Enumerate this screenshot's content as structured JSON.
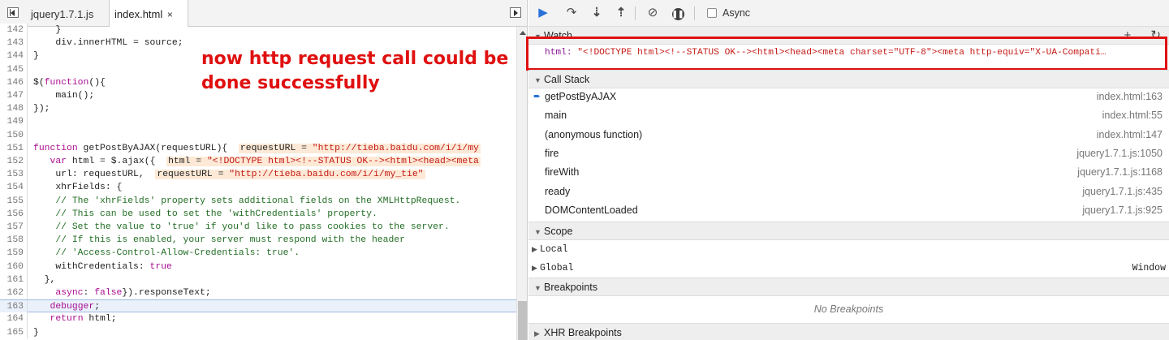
{
  "editor": {
    "tabs": [
      {
        "label": "jquery1.7.1.js"
      },
      {
        "label": "index.html",
        "close": "×"
      }
    ],
    "lines": [
      {
        "n": "142",
        "html": "    }"
      },
      {
        "n": "143",
        "html": "    div.innerHTML = source;"
      },
      {
        "n": "144",
        "html": "}"
      },
      {
        "n": "145",
        "html": ""
      },
      {
        "n": "146",
        "html": "$(<span class=\"kw\">function</span>(){"
      },
      {
        "n": "147",
        "html": "    main();"
      },
      {
        "n": "148",
        "html": "});"
      },
      {
        "n": "149",
        "html": ""
      },
      {
        "n": "150",
        "html": ""
      },
      {
        "n": "151",
        "html": "<span class=\"kw\">function</span> getPostByAJAX(requestURL){  <span class=\"inl\">requestURL = <span class=\"s\">\"http://tieba.baidu.com/i/i/my</span></span>"
      },
      {
        "n": "152",
        "html": "   <span class=\"kw\">var</span> html = $.ajax({  <span class=\"inl\">html = <span class=\"s\">\"&lt;!DOCTYPE html&gt;&lt;!--STATUS OK--&gt;&lt;html&gt;&lt;head&gt;&lt;meta</span></span>"
      },
      {
        "n": "153",
        "html": "    url: requestURL,  <span class=\"inl\">requestURL = <span class=\"s\">\"http://tieba.baidu.com/i/i/my_tie\"</span></span>"
      },
      {
        "n": "154",
        "html": "    xhrFields: {"
      },
      {
        "n": "155",
        "html": "    <span class=\"cm\">// The 'xhrFields' property sets additional fields on the XMLHttpRequest.</span>"
      },
      {
        "n": "156",
        "html": "    <span class=\"cm\">// This can be used to set the 'withCredentials' property.</span>"
      },
      {
        "n": "157",
        "html": "    <span class=\"cm\">// Set the value to 'true' if you'd like to pass cookies to the server.</span>"
      },
      {
        "n": "158",
        "html": "    <span class=\"cm\">// If this is enabled, your server must respond with the header</span>"
      },
      {
        "n": "159",
        "html": "    <span class=\"cm\">// 'Access-Control-Allow-Credentials: true'.</span>"
      },
      {
        "n": "160",
        "html": "    withCredentials: <span class=\"kw\">true</span>"
      },
      {
        "n": "161",
        "html": "  },"
      },
      {
        "n": "162",
        "html": "    <span class=\"kw\">async</span>: <span class=\"kw\">false</span>}).responseText;"
      },
      {
        "n": "163",
        "html": "   <span class=\"kw\">debugger</span>;",
        "exec": true
      },
      {
        "n": "164",
        "html": "   <span class=\"kw\">return</span> html;"
      },
      {
        "n": "165",
        "html": "}"
      }
    ],
    "annotation": {
      "line1": "now http request call could be",
      "line2": "done successfully"
    }
  },
  "toolbar": {
    "async_label": "Async"
  },
  "watch": {
    "title": "Watch",
    "add": "+",
    "refresh": "↻",
    "key": "html:",
    "value": "\"<!DOCTYPE html><!--STATUS OK--><html><head><meta charset=\"UTF-8\"><meta http-equiv=\"X-UA-Compati…"
  },
  "call_stack": {
    "title": "Call Stack",
    "frames": [
      {
        "name": "getPostByAJAX",
        "loc": "index.html:163",
        "current": true
      },
      {
        "name": "main",
        "loc": "index.html:55"
      },
      {
        "name": "(anonymous function)",
        "loc": "index.html:147"
      },
      {
        "name": "fire",
        "loc": "jquery1.7.1.js:1050"
      },
      {
        "name": "fireWith",
        "loc": "jquery1.7.1.js:1168"
      },
      {
        "name": "ready",
        "loc": "jquery1.7.1.js:435"
      },
      {
        "name": "DOMContentLoaded",
        "loc": "jquery1.7.1.js:925"
      }
    ]
  },
  "scope": {
    "title": "Scope",
    "local": "Local",
    "global": "Global",
    "global_value": "Window"
  },
  "breakpoints": {
    "title": "Breakpoints",
    "empty": "No Breakpoints"
  },
  "xhr_breakpoints": {
    "title": "XHR Breakpoints"
  }
}
